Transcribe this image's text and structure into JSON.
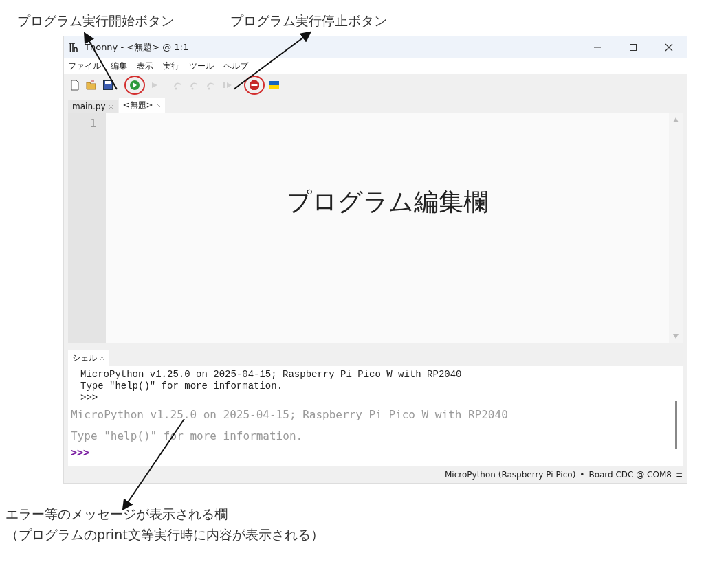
{
  "annotations": {
    "run_label": "プログラム実行開始ボタン",
    "stop_label": "プログラム実行停止ボタン",
    "editor_label": "プログラム編集欄",
    "shell_label": [
      "エラー等のメッセージが表示される欄",
      "（プログラムのprint文等実行時に内容が表示される）"
    ]
  },
  "window": {
    "title": "Thonny - <無題> @ 1:1"
  },
  "menu": [
    "ファイル",
    "編集",
    "表示",
    "実行",
    "ツール",
    "ヘルプ"
  ],
  "toolbar": [
    {
      "kind": "new",
      "disabled": false,
      "circled": false
    },
    {
      "kind": "open",
      "disabled": false,
      "circled": false
    },
    {
      "kind": "save",
      "disabled": false,
      "circled": false
    },
    {
      "kind": "run",
      "disabled": false,
      "circled": true
    },
    {
      "kind": "debug",
      "disabled": true,
      "circled": false
    },
    {
      "kind": "step-over",
      "disabled": true,
      "circled": false
    },
    {
      "kind": "step-into",
      "disabled": true,
      "circled": false
    },
    {
      "kind": "step-out",
      "disabled": true,
      "circled": false
    },
    {
      "kind": "resume",
      "disabled": true,
      "circled": false
    },
    {
      "kind": "stop",
      "disabled": false,
      "circled": true
    },
    {
      "kind": "flag",
      "disabled": false,
      "circled": false
    }
  ],
  "tabs": [
    {
      "label": "main.py",
      "selected": false
    },
    {
      "label": "<無題>",
      "selected": true
    }
  ],
  "editor": {
    "line_numbers": [
      "1"
    ]
  },
  "shell": {
    "tab": "シェル",
    "lines": [
      {
        "kind": "output",
        "text": "MicroPython v1.25.0 on 2025-04-15; Raspberry Pi Pico W with RP2040"
      },
      {
        "kind": "output",
        "text": "Type \"help()\" for more information."
      },
      {
        "kind": "output",
        "text": ">>>"
      },
      {
        "kind": "ghost",
        "text": "MicroPython v1.25.0 on 2025-04-15; Raspberry Pi Pico W with RP2040"
      },
      {
        "kind": "ghost",
        "text": "Type \"help()\" for more information."
      },
      {
        "kind": "prompt",
        "text": ">>>"
      }
    ]
  },
  "status_bar": {
    "interpreter": "MicroPython (Raspberry Pi Pico)",
    "separator": "•",
    "port": "Board CDC @ COM8",
    "menu": "≡"
  }
}
